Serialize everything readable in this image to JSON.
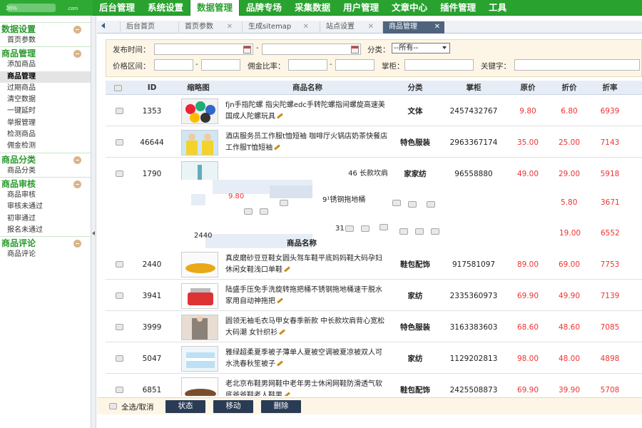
{
  "brand": {
    "text_left": "36%",
    "text_right": ".com"
  },
  "nav": [
    {
      "label": "后台管理"
    },
    {
      "label": "系统设置"
    },
    {
      "label": "数据管理"
    },
    {
      "label": "品牌专场"
    },
    {
      "label": "采集数据"
    },
    {
      "label": "用户管理"
    },
    {
      "label": "文章中心"
    },
    {
      "label": "插件管理"
    },
    {
      "label": "工具"
    }
  ],
  "sidebar": {
    "groups": [
      {
        "title": "数据设置",
        "items": [
          "首页参数"
        ]
      },
      {
        "title": "商品管理",
        "items": [
          "添加商品",
          "商品管理",
          "过期商品",
          "清空数据",
          "一键延时",
          "举报管理",
          "检测商品",
          "佣金检测"
        ]
      },
      {
        "title": "商品分类",
        "items": [
          "商品分类"
        ]
      },
      {
        "title": "商品审核",
        "items": [
          "商品审核",
          "审核未通过",
          "初审通过",
          "报名未通过"
        ]
      },
      {
        "title": "商品评论",
        "items": [
          "商品评论"
        ]
      }
    ]
  },
  "tabs": [
    {
      "label": "后台首页",
      "closable": false
    },
    {
      "label": "首页参数",
      "closable": true
    },
    {
      "label": "生成sitemap",
      "closable": true
    },
    {
      "label": "站点设置",
      "closable": true
    },
    {
      "label": "商品管理",
      "closable": true
    }
  ],
  "search": {
    "publish_time": "发布时间：",
    "category": "分类：",
    "category_value": "--所有--",
    "price_range": "价格区间：",
    "commission": "佣金比率：",
    "shop": "掌柜：",
    "keyword": "关键字：",
    "dash": "-"
  },
  "table": {
    "headers": [
      "ID",
      "缩略图",
      "商品名称",
      "分类",
      "掌柜",
      "原价",
      "折价",
      "折率"
    ],
    "rows": [
      {
        "id": "1353",
        "name": "fjn手指陀螺 指尖陀螺edc手转陀螺指间螺旋高速美国成人陀螺玩具",
        "cat": "文体",
        "shop": "2457432767",
        "price": "9.80",
        "disc": "6.80",
        "rate": "6939"
      },
      {
        "id": "46644",
        "name": "酒店服务员工作服t恤短袖 咖啡厅火锅店奶茶快餐店工作服T恤短袖",
        "cat": "特色服装",
        "shop": "2963367174",
        "price": "35.00",
        "disc": "25.00",
        "rate": "7143"
      },
      {
        "id": "1790",
        "name": "46  长款坎肩",
        "cat": "家家纺",
        "shop": "96558880",
        "price": "49.00",
        "disc": "29.00",
        "rate": "5918"
      },
      {
        "id": "2440",
        "name": "真皮磨砂豆豆鞋女圆头驾车鞋平底妈妈鞋大码孕妇休闲女鞋浅口单鞋",
        "cat": "鞋包配饰",
        "shop": "917581097",
        "price": "89.00",
        "disc": "69.00",
        "rate": "7753"
      },
      {
        "id": "3941",
        "name": "陆盛手压免手洗旋转拖把桶不锈钢拖地桶速干脱水家用自动神拖把",
        "cat": "家纺",
        "shop": "2335360973",
        "price": "69.90",
        "disc": "49.90",
        "rate": "7139"
      },
      {
        "id": "3999",
        "name": "圆领无袖毛衣马甲女春季新款 中长款坎肩背心宽松大码潮 女针织衫",
        "cat": "特色服装",
        "shop": "3163383603",
        "price": "68.60",
        "disc": "48.60",
        "rate": "7085"
      },
      {
        "id": "5047",
        "name": "雅绿超柔夏季被子薄单人夏被空调被夏凉被双人可水洗春秋笙被子",
        "cat": "家纺",
        "shop": "1129202813",
        "price": "98.00",
        "disc": "48.00",
        "rate": "4898"
      },
      {
        "id": "6851",
        "name": "老北京布鞋男网鞋中老年男士休闲网鞋防滑透气软底爸爸鞋老人鞋男",
        "cat": "鞋包配饰",
        "shop": "2425508873",
        "price": "69.90",
        "disc": "39.90",
        "rate": "5708"
      }
    ]
  },
  "glitch": {
    "price": "9.80",
    "name_frag": "9¹锈钢拖地桶",
    "id_frag": "2440",
    "header_frag": "商品名称",
    "num_frag": "31",
    "disc1": "5.80",
    "rate1": "3671",
    "disc2": "19.00",
    "rate2": "6552"
  },
  "footer": {
    "select_all": "全选/取消",
    "btn_status": "状态",
    "btn_move": "移动",
    "btn_delete": "删除"
  }
}
